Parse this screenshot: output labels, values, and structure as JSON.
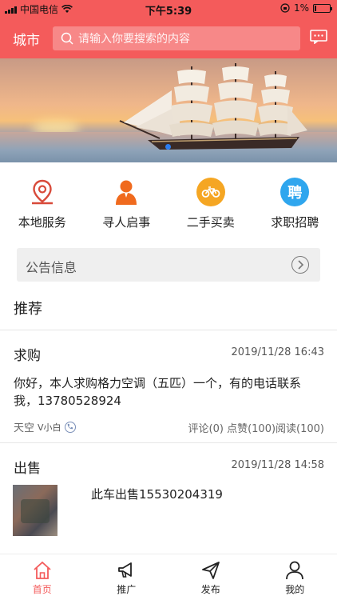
{
  "status": {
    "carrier": "中国电信",
    "time": "下午5:39",
    "battery": "1%"
  },
  "header": {
    "city": "城市",
    "search_placeholder": "请输入你要搜索的内容"
  },
  "quick_nav": [
    {
      "label": "本地服务",
      "icon": "location-pin-icon"
    },
    {
      "label": "寻人启事",
      "icon": "person-icon"
    },
    {
      "label": "二手买卖",
      "icon": "bicycle-icon"
    },
    {
      "label": "求职招聘",
      "icon": "hire-icon",
      "glyph": "聘"
    }
  ],
  "notice": {
    "label": "公告信息"
  },
  "section": {
    "title": "推荐"
  },
  "posts": [
    {
      "category": "求购",
      "time": "2019/11/28 16:43",
      "content": "你好，本人求购格力空调（五匹）一个，有的电话联系我，13780528924",
      "author": "天空",
      "vip": "V小白",
      "stats": "评论(0) 点赞(100)阅读(100)"
    },
    {
      "category": "出售",
      "time": "2019/11/28 14:58",
      "content": "此车出售15530204319"
    }
  ],
  "tabs": [
    {
      "label": "首页",
      "icon": "home-icon",
      "active": true
    },
    {
      "label": "推广",
      "icon": "megaphone-icon",
      "active": false
    },
    {
      "label": "发布",
      "icon": "send-icon",
      "active": false
    },
    {
      "label": "我的",
      "icon": "user-icon",
      "active": false
    }
  ],
  "colors": {
    "accent": "#f45b5b",
    "orange": "#f06a1e",
    "bike_bg": "#f5a623",
    "hire_bg": "#2fa6ee"
  }
}
